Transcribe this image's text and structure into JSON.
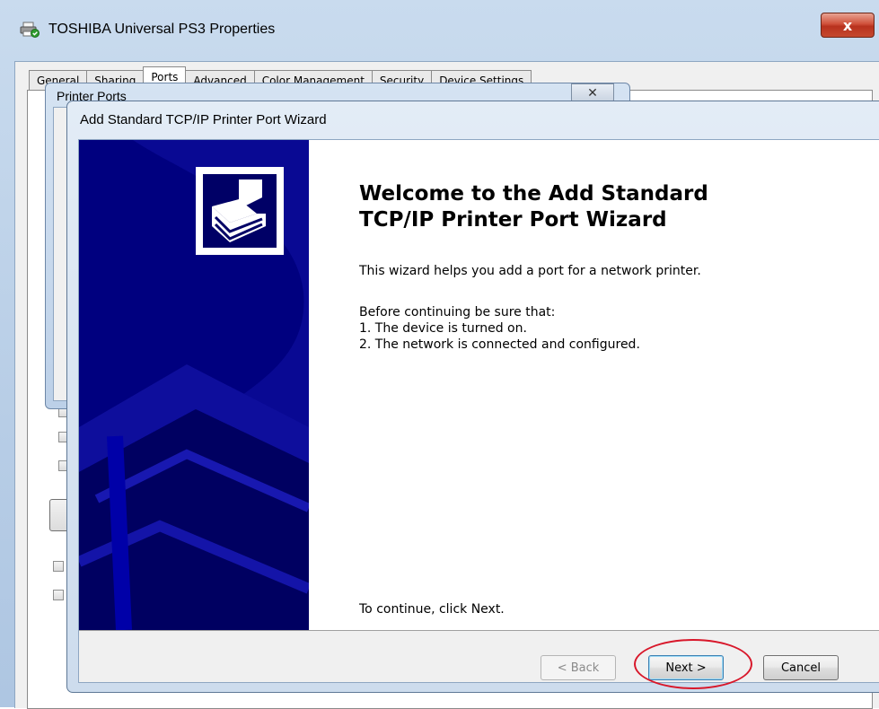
{
  "outer_window": {
    "title": "TOSHIBA Universal PS3 Properties",
    "close_glyph": "x",
    "tabs": [
      {
        "label": "General"
      },
      {
        "label": "Sharing"
      },
      {
        "label": "Ports"
      },
      {
        "label": "Advanced"
      },
      {
        "label": "Color Management"
      },
      {
        "label": "Security"
      },
      {
        "label": "Device Settings"
      }
    ],
    "active_tab": "Ports"
  },
  "ports_dialog": {
    "title": "Printer Ports",
    "close_glyph": "✕"
  },
  "wizard": {
    "title": "Add Standard TCP/IP Printer Port Wizard",
    "heading": "Welcome to the Add Standard\nTCP/IP Printer Port Wizard",
    "intro": "This wizard helps you add a port for a network printer.",
    "checklist_intro": "Before continuing be sure that:",
    "checklist": [
      "1.  The device is turned on.",
      "2.  The network is connected and configured."
    ],
    "continue_text": "To continue, click Next.",
    "buttons": {
      "back": "< Back",
      "next": "Next >",
      "cancel": "Cancel"
    },
    "banner_color": "#00007f"
  },
  "annotation": {
    "color": "#d8172a",
    "highlights": "Next >"
  }
}
